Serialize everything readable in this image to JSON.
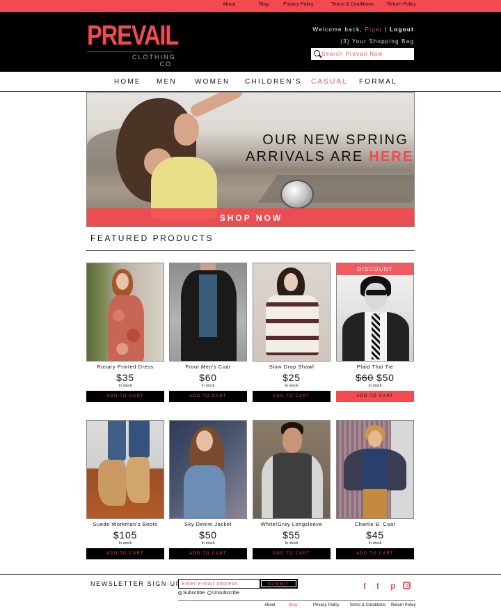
{
  "top_links": [
    "About",
    "Blog",
    "Privacy Policy",
    "Terms & Conditions",
    "Return Policy"
  ],
  "brand": {
    "name": "PREVAIL",
    "sub_line1": "CLOTHING",
    "sub_line2": "CO"
  },
  "account": {
    "welcome": "Welcome back, ",
    "username": "Piper",
    "separator": " | ",
    "logout": "Logout",
    "bag": "(3) Your Shopping Bag"
  },
  "search": {
    "placeholder": "Search Prevail Now",
    "icon": "search-icon"
  },
  "nav": {
    "items": [
      "HOME",
      "MEN",
      "WOMEN",
      "CHILDREN'S",
      "CASUAL",
      "FORMAL"
    ],
    "active": "CASUAL"
  },
  "hero": {
    "line1": "OUR NEW SPRING",
    "line2_prefix": "ARRIVALS ARE ",
    "line2_highlight": "HERE",
    "cta": "SHOP NOW"
  },
  "featured": {
    "title": "FEATURED PRODUCTS",
    "cart_label": "ADD TO CART",
    "products": [
      {
        "name": "Rosary Printed Dress",
        "price": "$35",
        "stock": "In stock"
      },
      {
        "name": "Froot Men's Coat",
        "price": "$60",
        "stock": "In stock"
      },
      {
        "name": "Slow Drop Shawl",
        "price": "$25",
        "stock": "In stock"
      },
      {
        "name": "Plaid Thai Tie",
        "old_price": "$60",
        "price": "$50",
        "stock": "In stock",
        "badge": "DISCOUNT"
      },
      {
        "name": "Suede Workman's Boots",
        "price": "$105",
        "stock": "In stock"
      },
      {
        "name": "Sky Denim Jacket",
        "price": "$50",
        "stock": "In stock"
      },
      {
        "name": "White/Grey Longsleeve",
        "price": "$55",
        "stock": "In stock"
      },
      {
        "name": "Charlie B. Coat",
        "price": "$45",
        "stock": "In stock"
      }
    ]
  },
  "newsletter": {
    "label": "NEWSLETTER SIGN-UP",
    "placeholder": "Enter e-mail address",
    "submit": "SUBMIT",
    "subscribe": "Subscribe",
    "unsubscribe": "Unsubscribe",
    "selected": "Subscribe"
  },
  "social": [
    "f",
    "t",
    "p",
    "instagram"
  ],
  "footer_links": [
    "About",
    "Blog",
    "Privacy Policy",
    "Terms & Conditions",
    "Return Policy"
  ],
  "footer_active": "Blog",
  "colors": {
    "accent": "#f24a50",
    "dark": "#000000",
    "text": "#111111"
  }
}
